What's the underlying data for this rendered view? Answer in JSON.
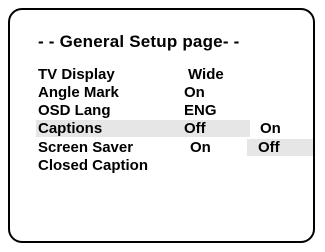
{
  "page": {
    "title": "- - General Setup page- -"
  },
  "settings": [
    {
      "label": "TV Display",
      "value": "Wide"
    },
    {
      "label": "Angle Mark",
      "value": "On"
    },
    {
      "label": "OSD Lang",
      "value": "ENG"
    },
    {
      "label": "Captions",
      "value": "Off"
    },
    {
      "label": "Screen Saver",
      "value": "On"
    },
    {
      "label": "Closed Caption",
      "value": ""
    }
  ],
  "submenu": {
    "options": [
      "On",
      "Off"
    ],
    "selected": "Off"
  },
  "colors": {
    "background": "#ffffff",
    "text": "#000000",
    "highlight": "#e6e6e6"
  }
}
